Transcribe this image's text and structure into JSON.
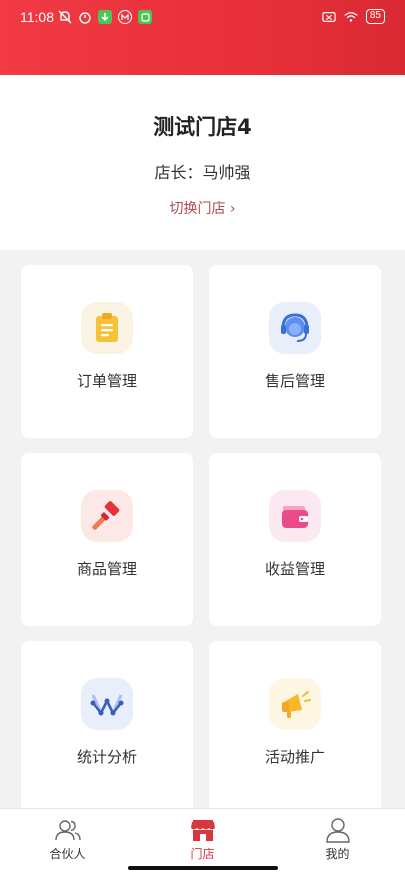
{
  "status_bar": {
    "time": "11:08",
    "battery": "85"
  },
  "store": {
    "name": "测试门店4",
    "manager": "店长：马帅强",
    "switch_label": "切换门店 ›"
  },
  "menu": [
    {
      "label": "订单管理",
      "icon": "clipboard-icon",
      "bg": "#fbf3e4"
    },
    {
      "label": "售后管理",
      "icon": "headset-icon",
      "bg": "#e8eefa"
    },
    {
      "label": "商品管理",
      "icon": "hammer-icon",
      "bg": "#fde8e8"
    },
    {
      "label": "收益管理",
      "icon": "wallet-icon",
      "bg": "#fbe8f1"
    },
    {
      "label": "统计分析",
      "icon": "chart-icon",
      "bg": "#e8eefa"
    },
    {
      "label": "活动推广",
      "icon": "megaphone-icon",
      "bg": "#fdf6e3"
    }
  ],
  "nav": {
    "partner": "合伙人",
    "store": "门店",
    "mine": "我的"
  },
  "colors": {
    "accent": "#e8303a",
    "switch_link": "#b34a4a"
  }
}
